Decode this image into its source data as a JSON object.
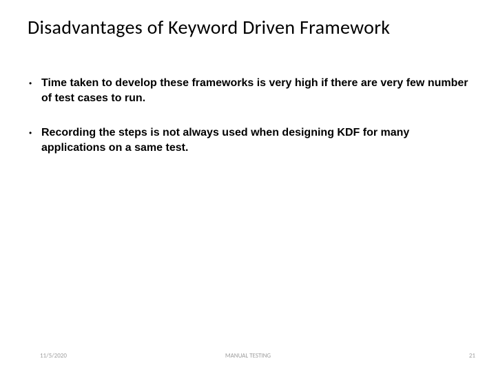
{
  "title": "Disadvantages of Keyword Driven Framework",
  "bullets": [
    "Time taken to develop these frameworks is very high if there are very few number of test cases to run.",
    "Recording the steps is not always used when designing KDF for many applications on a same test."
  ],
  "footer": {
    "date": "11/5/2020",
    "center": "MANUAL TESTING",
    "page": "21"
  }
}
